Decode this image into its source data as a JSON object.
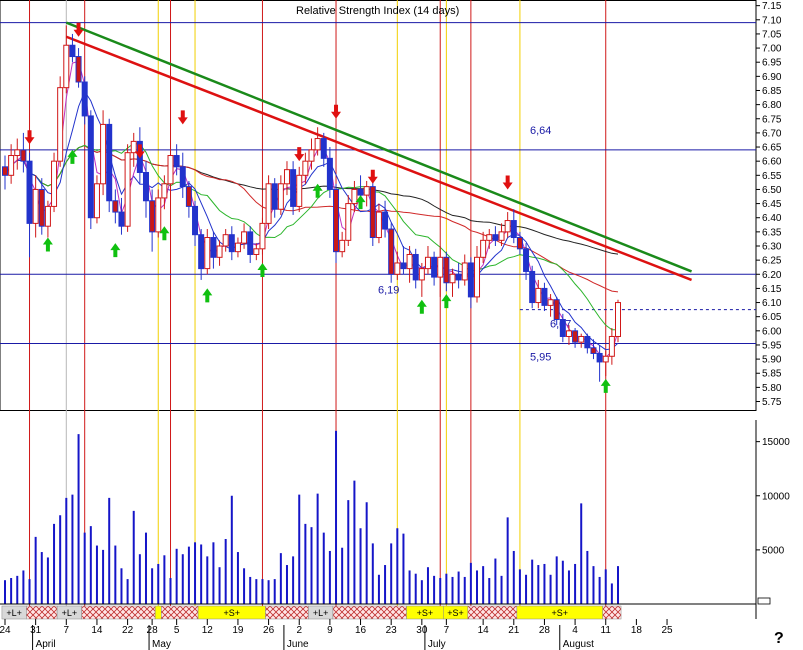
{
  "chart_data": {
    "type": "candlestick",
    "title": "Relative Strength Index (14 days)",
    "price_axis": {
      "range": [
        5.72,
        7.17
      ],
      "ticks": [
        "7.15",
        "7.10",
        "7.05",
        "7.00",
        "6.95",
        "6.90",
        "6.85",
        "6.80",
        "6.75",
        "6.70",
        "6.65",
        "6.60",
        "6.55",
        "6.50",
        "6.45",
        "6.40",
        "6.35",
        "6.30",
        "6.25",
        "6.20",
        "6.15",
        "6.10",
        "6.05",
        "6.00",
        "5.95",
        "5.90",
        "5.85",
        "5.80",
        "5.75"
      ]
    },
    "volume_axis": {
      "range": [
        0,
        17000
      ],
      "ticks": [
        {
          "value": 15000,
          "label": "15000"
        },
        {
          "value": 10000,
          "label": "10000"
        },
        {
          "value": 5000,
          "label": "5000"
        }
      ]
    },
    "x_day_ticks": [
      {
        "idx": 0,
        "label": "24"
      },
      {
        "idx": 5,
        "label": "31"
      },
      {
        "idx": 10,
        "label": "7"
      },
      {
        "idx": 15,
        "label": "14"
      },
      {
        "idx": 20,
        "label": "22"
      },
      {
        "idx": 24,
        "label": "28"
      },
      {
        "idx": 28,
        "label": "5"
      },
      {
        "idx": 33,
        "label": "12"
      },
      {
        "idx": 38,
        "label": "19"
      },
      {
        "idx": 43,
        "label": "26"
      },
      {
        "idx": 48,
        "label": "2"
      },
      {
        "idx": 53,
        "label": "9"
      },
      {
        "idx": 58,
        "label": "16"
      },
      {
        "idx": 63,
        "label": "23"
      },
      {
        "idx": 68,
        "label": "30"
      },
      {
        "idx": 72,
        "label": "7"
      },
      {
        "idx": 78,
        "label": "14"
      },
      {
        "idx": 83,
        "label": "21"
      },
      {
        "idx": 88,
        "label": "28"
      },
      {
        "idx": 93,
        "label": "4"
      },
      {
        "idx": 98,
        "label": "11"
      },
      {
        "idx": 103,
        "label": "18"
      },
      {
        "idx": 108,
        "label": "25"
      }
    ],
    "x_month_labels": [
      {
        "idx": 6,
        "label": "April"
      },
      {
        "idx": 25,
        "label": "May"
      },
      {
        "idx": 47,
        "label": "June"
      },
      {
        "idx": 70,
        "label": "July"
      },
      {
        "idx": 92,
        "label": "August"
      }
    ],
    "horizontal_levels": [
      {
        "value": 7.09,
        "label": ""
      },
      {
        "value": 6.64,
        "label": "6,64"
      },
      {
        "value": 6.2,
        "label": "6,19"
      },
      {
        "value": 6.075,
        "label": "6,07",
        "dashed": true
      },
      {
        "value": 5.955,
        "label": "5,95"
      }
    ],
    "trendlines": [
      {
        "name": "green",
        "color": "#1a8a1a",
        "from": [
          10,
          7.09
        ],
        "to": [
          112,
          6.21
        ]
      },
      {
        "name": "red",
        "color": "#dd1111",
        "from": [
          10,
          7.04
        ],
        "to": [
          112,
          6.18
        ]
      }
    ],
    "vertical_red_idx": [
      4,
      13,
      27,
      42,
      54,
      71,
      76,
      98
    ],
    "vertical_yellow_idx": [
      25,
      31,
      64,
      72,
      84
    ],
    "signal_arrows": [
      {
        "idx": 4,
        "dir": "down",
        "price": 6.66
      },
      {
        "idx": 7,
        "dir": "up",
        "price": 6.33
      },
      {
        "idx": 11,
        "dir": "up",
        "price": 6.64
      },
      {
        "idx": 12,
        "dir": "down",
        "price": 7.04
      },
      {
        "idx": 18,
        "dir": "up",
        "price": 6.31
      },
      {
        "idx": 22,
        "dir": "down",
        "price": 6.61
      },
      {
        "idx": 26,
        "dir": "up",
        "price": 6.37
      },
      {
        "idx": 29,
        "dir": "down",
        "price": 6.73
      },
      {
        "idx": 33,
        "dir": "up",
        "price": 6.15
      },
      {
        "idx": 42,
        "dir": "up",
        "price": 6.24
      },
      {
        "idx": 48,
        "dir": "down",
        "price": 6.6
      },
      {
        "idx": 51,
        "dir": "up",
        "price": 6.52
      },
      {
        "idx": 54,
        "dir": "down",
        "price": 6.75
      },
      {
        "idx": 58,
        "dir": "up",
        "price": 6.48
      },
      {
        "idx": 60,
        "dir": "down",
        "price": 6.52
      },
      {
        "idx": 68,
        "dir": "up",
        "price": 6.11
      },
      {
        "idx": 72,
        "dir": "up",
        "price": 6.13
      },
      {
        "idx": 82,
        "dir": "down",
        "price": 6.5
      },
      {
        "idx": 98,
        "dir": "up",
        "price": 5.83
      }
    ],
    "signal_strip": [
      {
        "from": 0,
        "to": 3,
        "label": "+L+",
        "kind": "label"
      },
      {
        "from": 4,
        "to": 8,
        "label": "",
        "kind": "hatch"
      },
      {
        "from": 9,
        "to": 12,
        "label": "+L+",
        "kind": "label"
      },
      {
        "from": 13,
        "to": 24,
        "label": "",
        "kind": "hatch"
      },
      {
        "from": 25,
        "to": 25,
        "label": "",
        "kind": "yellow"
      },
      {
        "from": 26,
        "to": 31,
        "label": "",
        "kind": "hatch"
      },
      {
        "from": 32,
        "to": 42,
        "label": "+S+",
        "kind": "yellow"
      },
      {
        "from": 43,
        "to": 49,
        "label": "",
        "kind": "hatch"
      },
      {
        "from": 50,
        "to": 53,
        "label": "+L+",
        "kind": "label"
      },
      {
        "from": 54,
        "to": 65,
        "label": "",
        "kind": "hatch"
      },
      {
        "from": 66,
        "to": 71,
        "label": "+S+",
        "kind": "yellow"
      },
      {
        "from": 72,
        "to": 75,
        "label": "+S+",
        "kind": "yellow"
      },
      {
        "from": 76,
        "to": 83,
        "label": "",
        "kind": "hatch"
      },
      {
        "from": 84,
        "to": 97,
        "label": "+S+",
        "kind": "yellow"
      },
      {
        "from": 98,
        "to": 100,
        "label": "",
        "kind": "hatch"
      }
    ],
    "candles": [
      [
        6.58,
        6.62,
        6.5,
        6.55
      ],
      [
        6.55,
        6.66,
        6.52,
        6.62
      ],
      [
        6.62,
        6.68,
        6.57,
        6.64
      ],
      [
        6.64,
        6.7,
        6.56,
        6.6
      ],
      [
        6.6,
        6.63,
        6.26,
        6.38
      ],
      [
        6.38,
        6.55,
        6.33,
        6.5
      ],
      [
        6.5,
        6.54,
        6.34,
        6.37
      ],
      [
        6.37,
        6.46,
        6.33,
        6.44
      ],
      [
        6.44,
        6.63,
        6.42,
        6.6
      ],
      [
        6.6,
        6.9,
        6.58,
        6.86
      ],
      [
        6.86,
        7.08,
        6.84,
        7.01
      ],
      [
        7.01,
        7.05,
        6.95,
        6.97
      ],
      [
        6.97,
        7.0,
        6.86,
        6.88
      ],
      [
        6.88,
        6.9,
        6.73,
        6.76
      ],
      [
        6.76,
        6.78,
        6.36,
        6.4
      ],
      [
        6.4,
        6.55,
        6.38,
        6.52
      ],
      [
        6.52,
        6.78,
        6.48,
        6.73
      ],
      [
        6.73,
        6.75,
        6.42,
        6.46
      ],
      [
        6.46,
        6.5,
        6.38,
        6.42
      ],
      [
        6.42,
        6.47,
        6.34,
        6.37
      ],
      [
        6.37,
        6.66,
        6.35,
        6.63
      ],
      [
        6.63,
        6.7,
        6.58,
        6.67
      ],
      [
        6.67,
        6.72,
        6.52,
        6.56
      ],
      [
        6.56,
        6.6,
        6.4,
        6.46
      ],
      [
        6.46,
        6.5,
        6.28,
        6.35
      ],
      [
        6.35,
        6.5,
        6.33,
        6.47
      ],
      [
        6.47,
        6.55,
        6.43,
        6.52
      ],
      [
        6.52,
        6.67,
        6.48,
        6.62
      ],
      [
        6.62,
        6.66,
        6.55,
        6.58
      ],
      [
        6.58,
        6.63,
        6.47,
        6.51
      ],
      [
        6.51,
        6.53,
        6.4,
        6.44
      ],
      [
        6.44,
        6.46,
        6.3,
        6.34
      ],
      [
        6.34,
        6.36,
        6.18,
        6.22
      ],
      [
        6.22,
        6.36,
        6.2,
        6.33
      ],
      [
        6.33,
        6.35,
        6.22,
        6.26
      ],
      [
        6.26,
        6.32,
        6.23,
        6.3
      ],
      [
        6.3,
        6.36,
        6.28,
        6.34
      ],
      [
        6.34,
        6.37,
        6.25,
        6.28
      ],
      [
        6.28,
        6.33,
        6.26,
        6.31
      ],
      [
        6.31,
        6.38,
        6.29,
        6.35
      ],
      [
        6.35,
        6.37,
        6.24,
        6.27
      ],
      [
        6.27,
        6.31,
        6.25,
        6.29
      ],
      [
        6.29,
        6.4,
        6.27,
        6.38
      ],
      [
        6.38,
        6.55,
        6.36,
        6.52
      ],
      [
        6.52,
        6.54,
        6.4,
        6.43
      ],
      [
        6.43,
        6.55,
        6.41,
        6.52
      ],
      [
        6.52,
        6.6,
        6.48,
        6.57
      ],
      [
        6.57,
        6.6,
        6.41,
        6.44
      ],
      [
        6.44,
        6.58,
        6.42,
        6.55
      ],
      [
        6.55,
        6.63,
        6.52,
        6.6
      ],
      [
        6.6,
        6.68,
        6.57,
        6.64
      ],
      [
        6.64,
        6.72,
        6.62,
        6.68
      ],
      [
        6.68,
        6.7,
        6.58,
        6.61
      ],
      [
        6.61,
        6.65,
        6.47,
        6.5
      ],
      [
        6.5,
        6.52,
        6.24,
        6.28
      ],
      [
        6.28,
        6.35,
        6.26,
        6.32
      ],
      [
        6.32,
        6.48,
        6.3,
        6.45
      ],
      [
        6.45,
        6.53,
        6.42,
        6.5
      ],
      [
        6.5,
        6.55,
        6.45,
        6.48
      ],
      [
        6.48,
        6.53,
        6.44,
        6.51
      ],
      [
        6.51,
        6.53,
        6.3,
        6.33
      ],
      [
        6.33,
        6.45,
        6.31,
        6.42
      ],
      [
        6.42,
        6.46,
        6.33,
        6.36
      ],
      [
        6.36,
        6.38,
        6.17,
        6.2
      ],
      [
        6.2,
        6.28,
        6.18,
        6.24
      ],
      [
        6.24,
        6.3,
        6.2,
        6.22
      ],
      [
        6.22,
        6.3,
        6.17,
        6.27
      ],
      [
        6.27,
        6.29,
        6.15,
        6.18
      ],
      [
        6.18,
        6.24,
        6.12,
        6.22
      ],
      [
        6.22,
        6.3,
        6.2,
        6.26
      ],
      [
        6.26,
        6.28,
        6.16,
        6.19
      ],
      [
        6.19,
        6.3,
        6.12,
        6.26
      ],
      [
        6.26,
        6.28,
        6.14,
        6.17
      ],
      [
        6.17,
        6.22,
        6.12,
        6.2
      ],
      [
        6.2,
        6.24,
        6.15,
        6.18
      ],
      [
        6.18,
        6.27,
        6.16,
        6.24
      ],
      [
        6.24,
        6.26,
        6.08,
        6.12
      ],
      [
        6.12,
        6.3,
        6.1,
        6.26
      ],
      [
        6.26,
        6.35,
        6.24,
        6.32
      ],
      [
        6.32,
        6.36,
        6.29,
        6.34
      ],
      [
        6.34,
        6.37,
        6.3,
        6.32
      ],
      [
        6.32,
        6.38,
        6.3,
        6.35
      ],
      [
        6.35,
        6.42,
        6.33,
        6.39
      ],
      [
        6.39,
        6.43,
        6.31,
        6.33
      ],
      [
        6.33,
        6.35,
        6.27,
        6.29
      ],
      [
        6.29,
        6.31,
        6.18,
        6.21
      ],
      [
        6.21,
        6.23,
        6.08,
        6.1
      ],
      [
        6.1,
        6.18,
        6.08,
        6.15
      ],
      [
        6.15,
        6.17,
        6.07,
        6.09
      ],
      [
        6.09,
        6.13,
        6.05,
        6.11
      ],
      [
        6.11,
        6.12,
        6.02,
        6.04
      ],
      [
        6.04,
        6.06,
        5.96,
        5.98
      ],
      [
        5.98,
        6.02,
        5.95,
        6.0
      ],
      [
        6.0,
        6.01,
        5.94,
        5.96
      ],
      [
        5.96,
        5.99,
        5.94,
        5.98
      ],
      [
        5.98,
        5.99,
        5.92,
        5.94
      ],
      [
        5.94,
        5.97,
        5.9,
        5.92
      ],
      [
        5.92,
        5.95,
        5.82,
        5.89
      ],
      [
        5.89,
        5.93,
        5.84,
        5.91
      ],
      [
        5.91,
        6.01,
        5.88,
        5.98
      ],
      [
        5.98,
        6.11,
        5.96,
        6.1
      ]
    ],
    "volumes": [
      2200,
      2400,
      2600,
      3100,
      2300,
      6200,
      4800,
      4300,
      7400,
      8200,
      9800,
      10100,
      15700,
      6600,
      7200,
      5400,
      5000,
      9800,
      5400,
      3300,
      2300,
      8600,
      4600,
      6600,
      3300,
      3700,
      4500,
      2400,
      5100,
      4600,
      5300,
      5700,
      5500,
      4400,
      5700,
      3400,
      6000,
      10000,
      4800,
      3300,
      2500,
      2300,
      2300,
      2200,
      2300,
      4700,
      3600,
      4400,
      10100,
      7400,
      7100,
      10200,
      6600,
      4900,
      16000,
      5200,
      9600,
      11400,
      7000,
      9400,
      5600,
      2700,
      3600,
      5600,
      7000,
      6500,
      3100,
      2800,
      2200,
      3400,
      2600,
      2400,
      2800,
      2500,
      3000,
      2500,
      3800,
      3100,
      3500,
      2400,
      4200,
      2600,
      8000,
      4900,
      3200,
      2700,
      4100,
      3600,
      3700,
      2700,
      4400,
      4000,
      3100,
      3700,
      9300,
      4900,
      3500,
      2500,
      3200,
      1900,
      3500
    ]
  },
  "ui": {
    "help_glyph": "?"
  }
}
